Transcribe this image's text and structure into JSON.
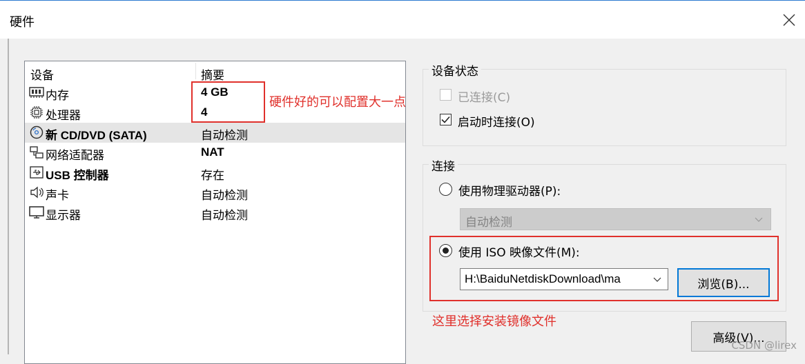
{
  "window": {
    "title": "硬件"
  },
  "device_list": {
    "headers": {
      "device": "设备",
      "summary": "摘要"
    },
    "rows": [
      {
        "icon": "memory-icon",
        "name": "内存",
        "summary": "4 GB"
      },
      {
        "icon": "cpu-icon",
        "name": "处理器",
        "summary": "4"
      },
      {
        "icon": "cd-dvd-icon",
        "name": "新 CD/DVD (SATA)",
        "summary": "自动检测"
      },
      {
        "icon": "network-adapter-icon",
        "name": "网络适配器",
        "summary": "NAT"
      },
      {
        "icon": "usb-icon",
        "name": "USB 控制器",
        "summary": "存在"
      },
      {
        "icon": "sound-card-icon",
        "name": "声卡",
        "summary": "自动检测"
      },
      {
        "icon": "display-icon",
        "name": "显示器",
        "summary": "自动检测"
      }
    ]
  },
  "annotations": {
    "top_note": "硬件好的可以配置大一点",
    "bottom_note": "这里选择安装镜像文件"
  },
  "device_status": {
    "legend": "设备状态",
    "connected": {
      "label": "已连接(C)",
      "checked": false,
      "enabled": false
    },
    "connect_at_power_on": {
      "label": "启动时连接(O)",
      "checked": true,
      "enabled": true
    }
  },
  "connection": {
    "legend": "连接",
    "physical_drive": {
      "label": "使用物理驱动器(P):",
      "selected": false
    },
    "physical_drive_select": {
      "value": "自动检测"
    },
    "iso_image": {
      "label": "使用 ISO 映像文件(M):",
      "selected": true
    },
    "iso_path": {
      "value": "H:\\BaiduNetdiskDownload\\ma"
    },
    "browse_button": "浏览(B)..."
  },
  "advanced_button": "高级(V)...",
  "watermark": "CSDN @lirex"
}
